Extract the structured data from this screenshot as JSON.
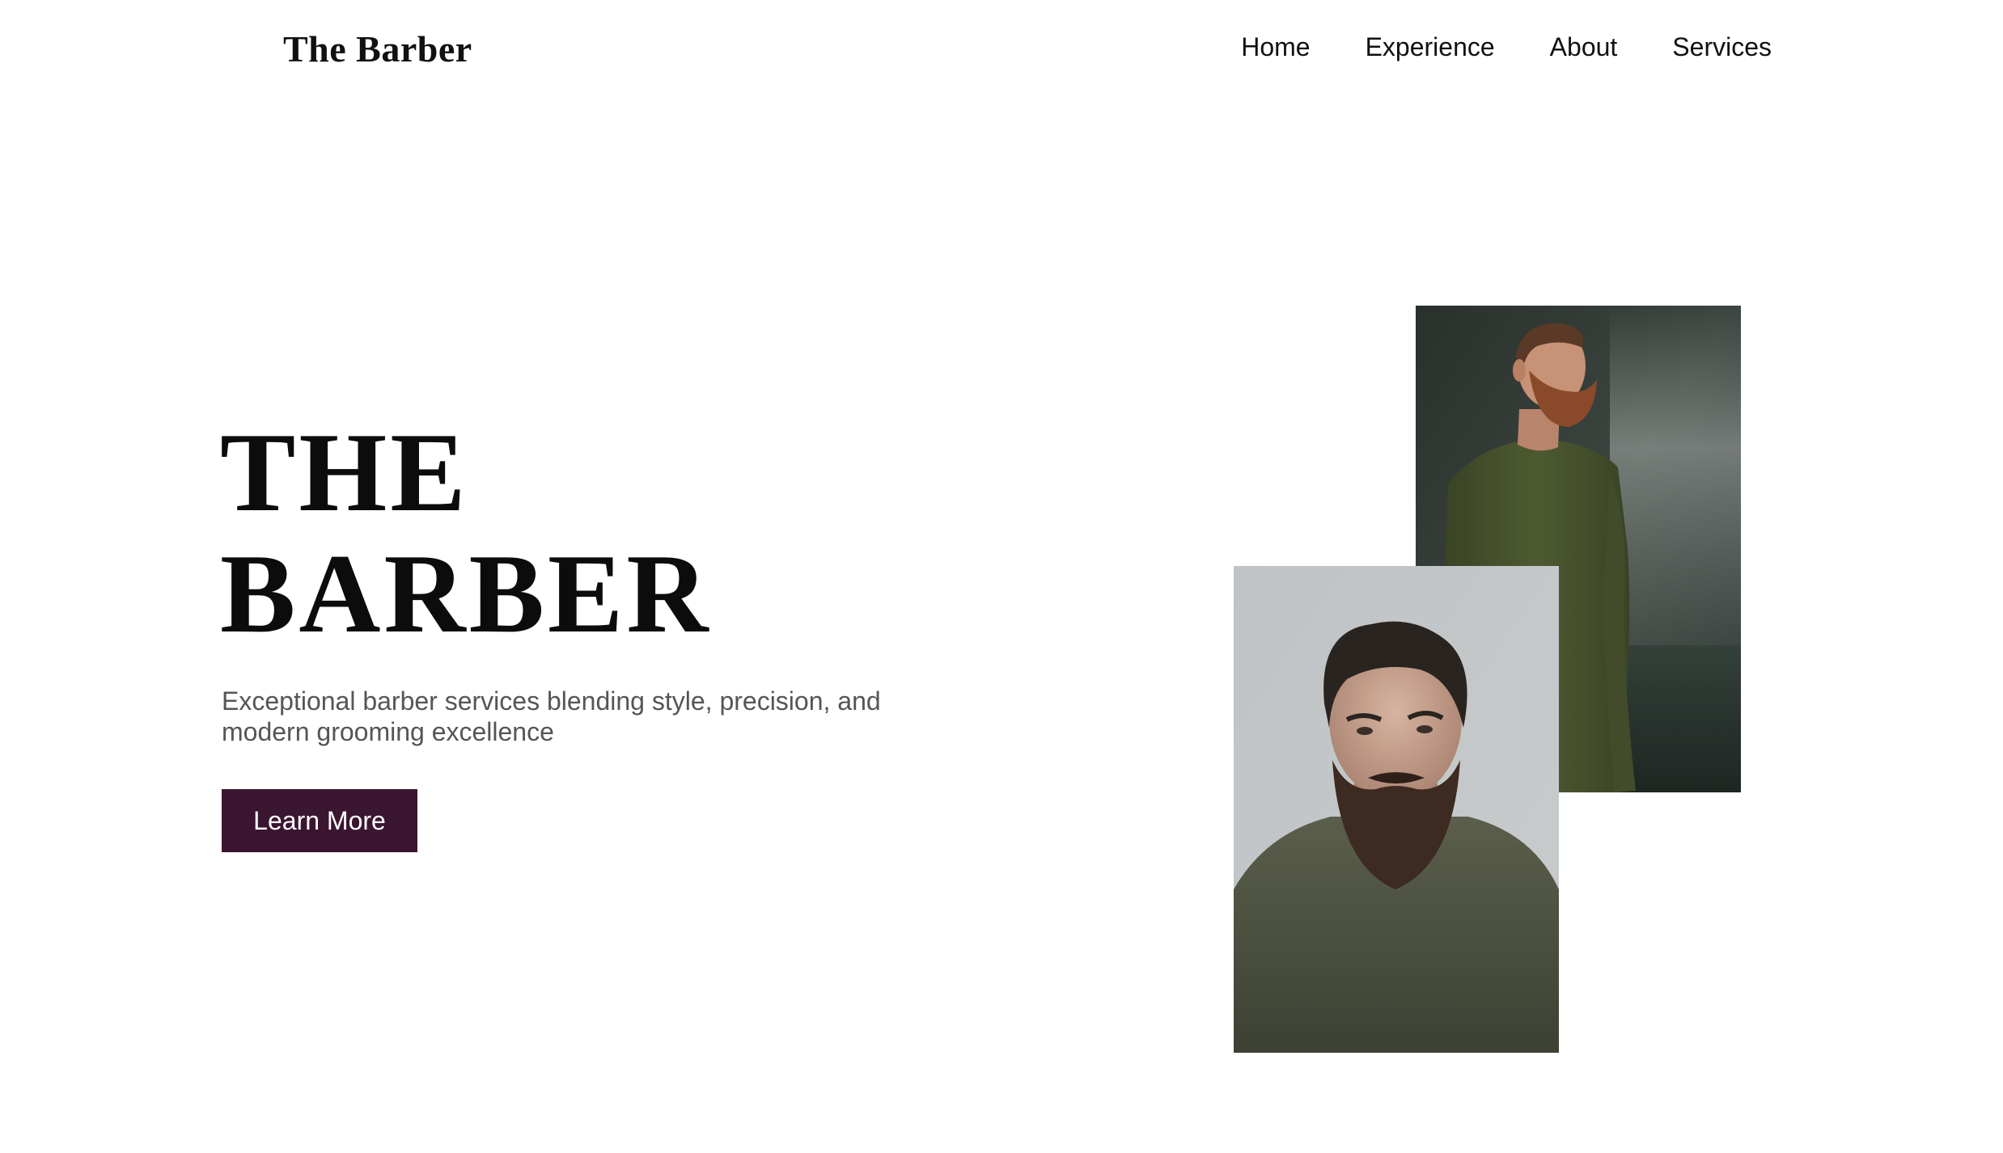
{
  "header": {
    "logo": "The Barber",
    "nav": [
      {
        "label": "Home"
      },
      {
        "label": "Experience"
      },
      {
        "label": "About"
      },
      {
        "label": "Services"
      }
    ]
  },
  "hero": {
    "title_line1": "THE",
    "title_line2": "BARBER",
    "subtitle": "Exceptional barber services blending style, precision, and modern grooming excellence",
    "cta_label": "Learn More"
  },
  "colors": {
    "accent": "#3b1630",
    "text": "#111111",
    "muted": "#555555",
    "background": "#ffffff"
  },
  "images": {
    "back": {
      "icon": "bearded-man-outdoor-photo"
    },
    "front": {
      "icon": "bearded-man-portrait-photo"
    }
  }
}
